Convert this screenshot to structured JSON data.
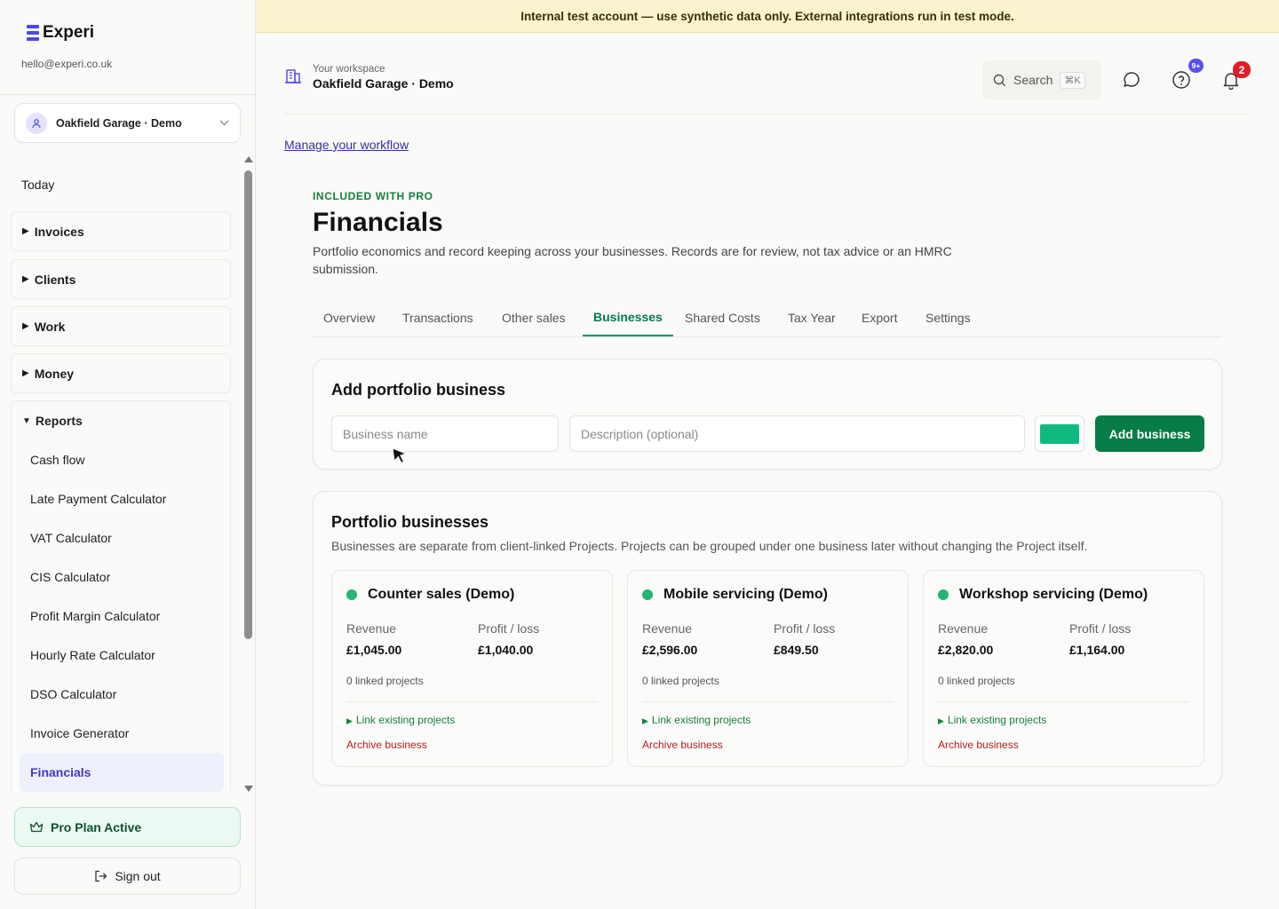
{
  "sidebar": {
    "brand": "Experi",
    "email": "hello@experi.co.uk",
    "workspace_switch": "Oakfield Garage · Demo",
    "today": "Today",
    "groups": [
      {
        "label": "Invoices"
      },
      {
        "label": "Clients"
      },
      {
        "label": "Work"
      },
      {
        "label": "Money"
      }
    ],
    "reports": {
      "label": "Reports",
      "items": [
        {
          "label": "Cash flow"
        },
        {
          "label": "Late Payment Calculator"
        },
        {
          "label": "VAT Calculator"
        },
        {
          "label": "CIS Calculator"
        },
        {
          "label": "Profit Margin Calculator"
        },
        {
          "label": "Hourly Rate Calculator"
        },
        {
          "label": "DSO Calculator"
        },
        {
          "label": "Invoice Generator"
        },
        {
          "label": "Financials"
        }
      ],
      "active": "Financials"
    },
    "pro_plan": "Pro Plan Active",
    "sign_out": "Sign out"
  },
  "banner": "Internal test account — use synthetic data only. External integrations run in test mode.",
  "header": {
    "workspace_label": "Your workspace",
    "workspace_name": "Oakfield Garage · Demo",
    "search_label": "Search",
    "search_shortcut": "⌘K",
    "help_badge": "9+",
    "notifications_badge": "2"
  },
  "manage_link": "Manage your workflow",
  "page": {
    "eyebrow": "INCLUDED WITH PRO",
    "title": "Financials",
    "description": "Portfolio economics and record keeping across your businesses. Records are for review, not tax advice or an HMRC submission."
  },
  "tabs": [
    {
      "label": "Overview"
    },
    {
      "label": "Transactions"
    },
    {
      "label": "Other sales"
    },
    {
      "label": "Businesses"
    },
    {
      "label": "Shared Costs"
    },
    {
      "label": "Tax Year"
    },
    {
      "label": "Export"
    },
    {
      "label": "Settings"
    }
  ],
  "active_tab": "Businesses",
  "add_form": {
    "title": "Add portfolio business",
    "name_placeholder": "Business name",
    "description_placeholder": "Description (optional)",
    "color": "#10b981",
    "submit": "Add business"
  },
  "portfolio": {
    "title": "Portfolio businesses",
    "subtitle": "Businesses are separate from client-linked Projects. Projects can be grouped under one business later without changing the Project itself.",
    "revenue_label": "Revenue",
    "profit_label": "Profit / loss",
    "link_label": "Link existing projects",
    "archive_label": "Archive business",
    "businesses": [
      {
        "name": "Counter sales (Demo)",
        "revenue": "£1,045.00",
        "profit": "£1,040.00",
        "linked": "0 linked projects"
      },
      {
        "name": "Mobile servicing (Demo)",
        "revenue": "£2,596.00",
        "profit": "£849.50",
        "linked": "0 linked projects"
      },
      {
        "name": "Workshop servicing (Demo)",
        "revenue": "£2,820.00",
        "profit": "£1,164.00",
        "linked": "0 linked projects"
      }
    ]
  },
  "colors": {
    "accent": "#4f46e5",
    "brand_green": "#067d46",
    "status_dot": "#22b573",
    "danger": "#b91c1c",
    "banner_bg": "#fbf3cf"
  }
}
